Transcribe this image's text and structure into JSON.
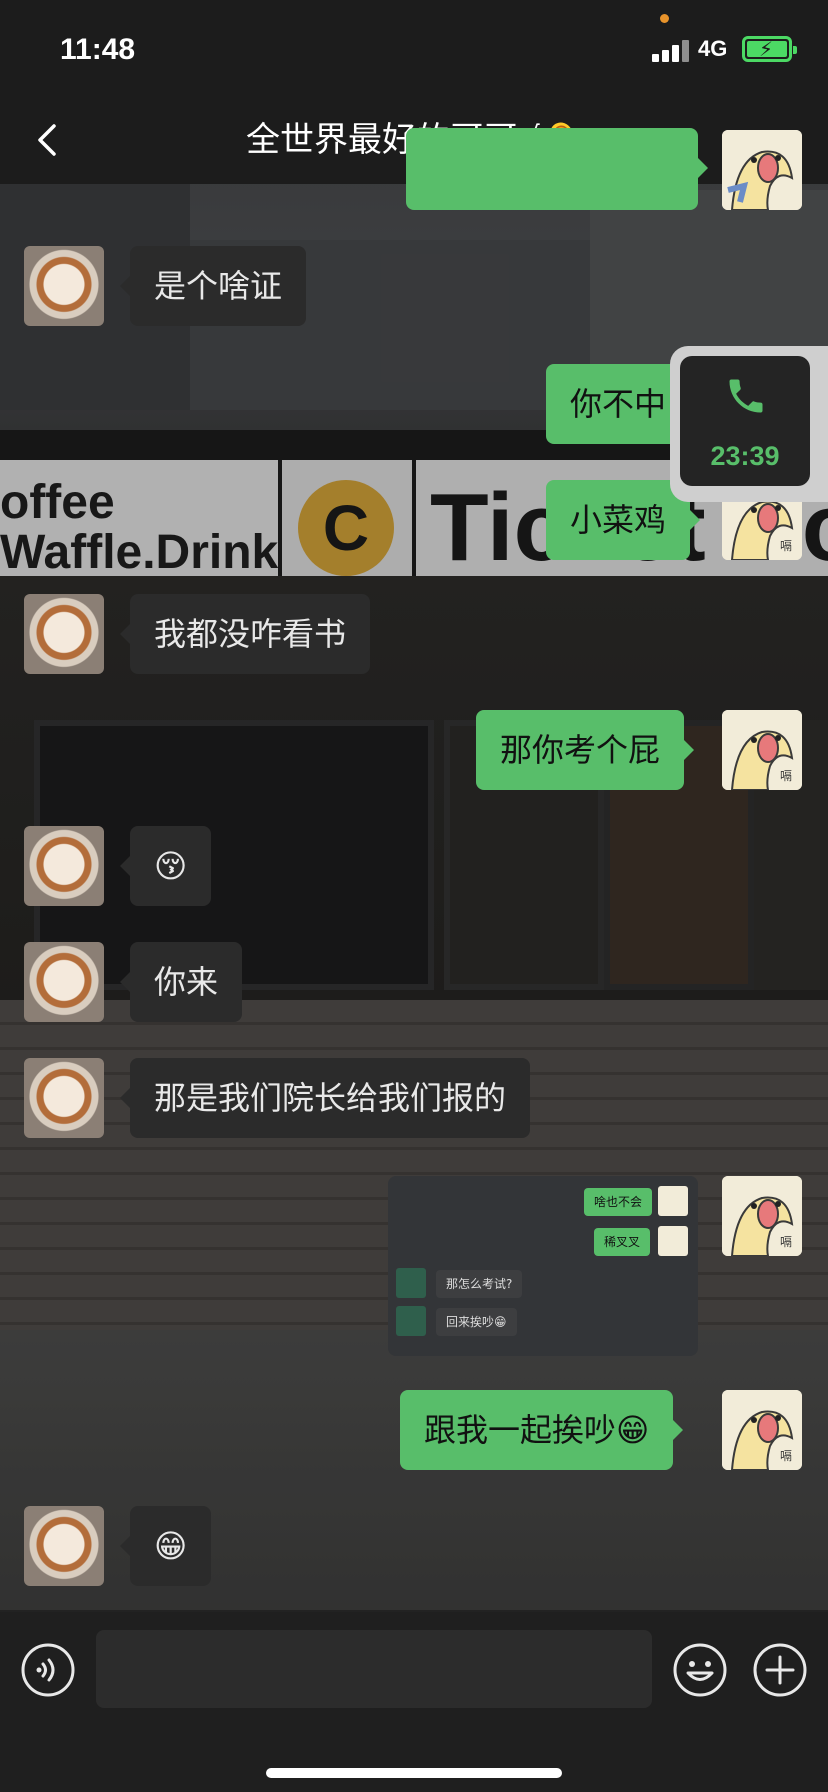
{
  "status_bar": {
    "time": "11:48",
    "network": "4G",
    "battery_color": "#4cd964"
  },
  "nav": {
    "title": "全世界最好的哥哥√👂",
    "back_icon": "chevron-left-icon",
    "more_icon": "more-dots-icon"
  },
  "background_scene": {
    "sign_left": "offee\nWaffle.Drink",
    "sign_badge": "C",
    "sign_right": "Ticket Bo"
  },
  "messages": [
    {
      "from": "them",
      "text": "是个啥证"
    },
    {
      "from": "me",
      "text": "你不中"
    },
    {
      "from": "me",
      "text": "小菜鸡"
    },
    {
      "from": "them",
      "text": "我都没咋看书"
    },
    {
      "from": "me",
      "text": "那你考个屁"
    },
    {
      "from": "them",
      "text": "😚"
    },
    {
      "from": "them",
      "text": "你来"
    },
    {
      "from": "them",
      "text": "那是我们院长给我们报的"
    },
    {
      "from": "me",
      "text": "跟我一起挨吵😁"
    },
    {
      "from": "them",
      "text": "😁"
    }
  ],
  "screenshot_message": {
    "lines": [
      {
        "from": "me",
        "text": "啥也不会"
      },
      {
        "from": "me",
        "text": "稀叉叉"
      },
      {
        "from": "them",
        "text": "那怎么考试?"
      },
      {
        "from": "them",
        "text": "回来挨吵😁"
      }
    ]
  },
  "me_avatar_label": "嗝",
  "floating_call": {
    "duration": "23:39",
    "accent": "#58be6a"
  },
  "input_bar": {
    "voice_icon": "voice-icon",
    "emoji_icon": "emoji-icon",
    "add_icon": "plus-circle-icon",
    "placeholder": ""
  },
  "colors": {
    "my_bubble": "#58be6a",
    "their_bubble": "#2b2b2b",
    "bar_bg": "#1c1c1c"
  }
}
